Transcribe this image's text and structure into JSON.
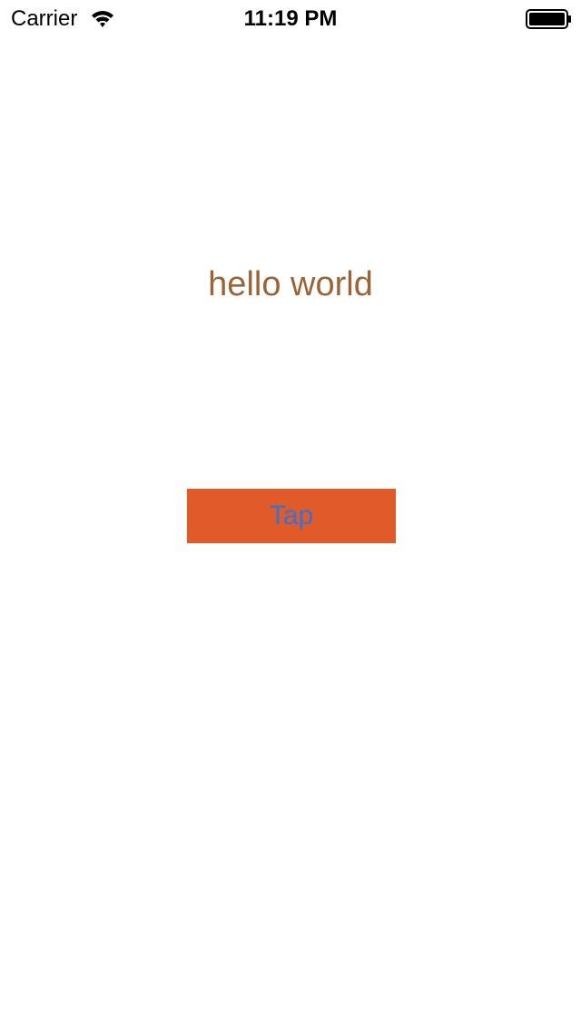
{
  "status_bar": {
    "carrier": "Carrier",
    "time": "11:19 PM",
    "wifi_icon": "wifi-icon",
    "battery_icon": "battery-icon",
    "battery_level": 1.0
  },
  "main": {
    "greeting": "hello world",
    "greeting_color": "#9a6436",
    "tap_label": "Tap",
    "tap_background": "#e05a2a",
    "tap_text_color": "#3573d4"
  }
}
